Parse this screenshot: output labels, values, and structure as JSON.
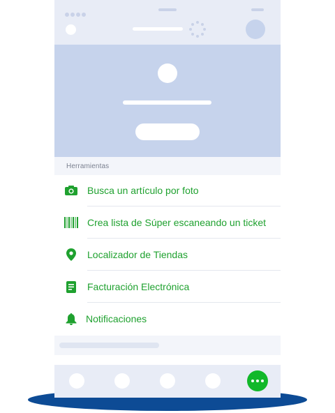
{
  "colors": {
    "accent_green": "#1fa12f",
    "tab_active": "#12b82a",
    "header_blue": "#c6d3ec",
    "bar_gray": "#e8ecf6",
    "footer_blue": "#0d4b95"
  },
  "tools": {
    "section_title": "Herramientas",
    "items": [
      {
        "label": "Busca un artículo por foto",
        "icon": "camera-icon"
      },
      {
        "label": "Crea lista de Súper escaneando un ticket",
        "icon": "barcode-icon"
      },
      {
        "label": "Localizador de Tiendas",
        "icon": "map-pin-icon"
      },
      {
        "label": "Facturación Electrónica",
        "icon": "document-icon"
      },
      {
        "label": "Notificaciones",
        "icon": "bell-icon"
      }
    ]
  },
  "tabbar": {
    "tabs": [
      {
        "icon": "tab-placeholder-icon"
      },
      {
        "icon": "tab-placeholder-icon"
      },
      {
        "icon": "tab-placeholder-icon"
      },
      {
        "icon": "tab-placeholder-icon"
      },
      {
        "icon": "more-icon"
      }
    ]
  }
}
